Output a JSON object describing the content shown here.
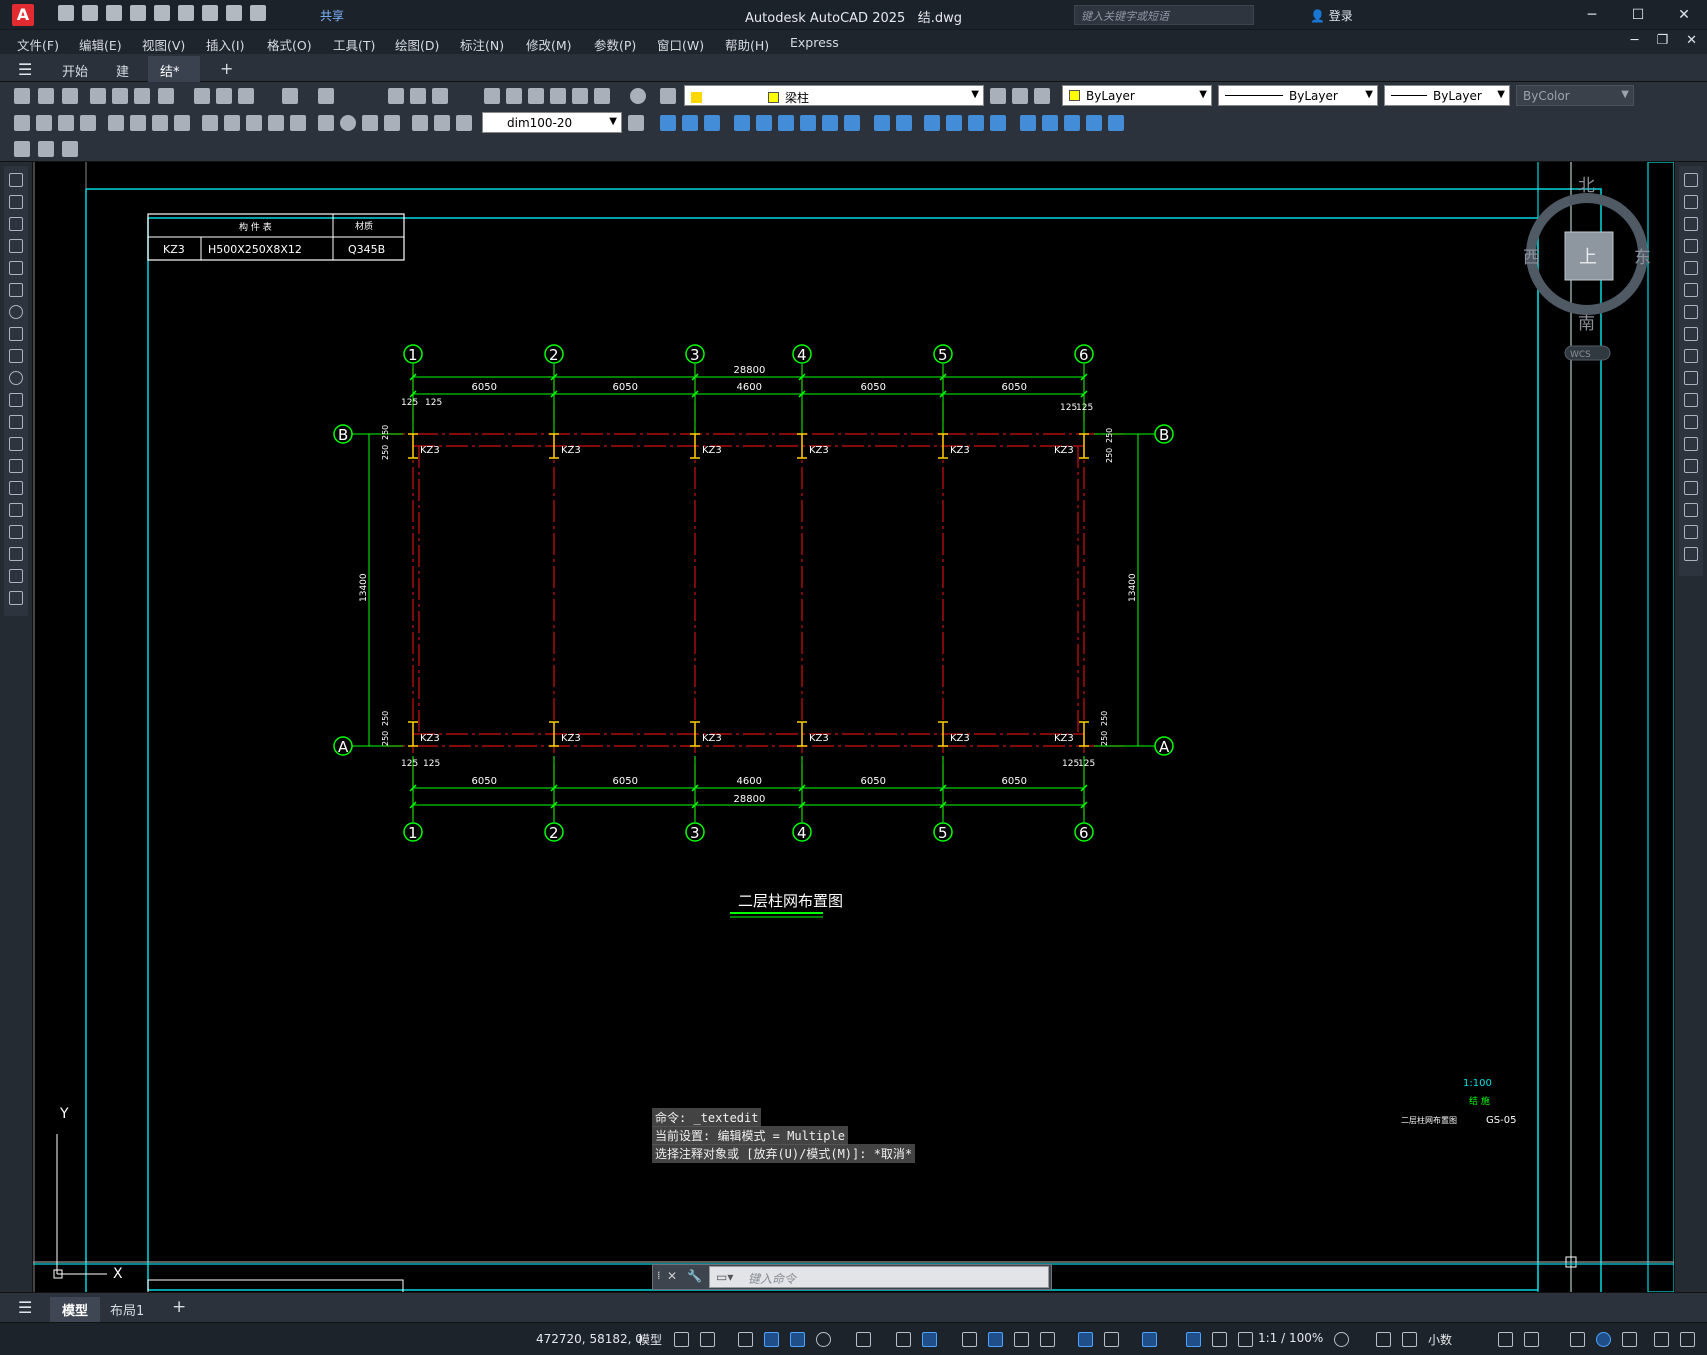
{
  "app": {
    "title": "Autodesk AutoCAD 2025",
    "document": "结.dwg",
    "logo": "A",
    "share": "共享",
    "search_placeholder": "键入关键字或短语",
    "login": "登录"
  },
  "window": {
    "minimize": "─",
    "maximize": "☐",
    "close": "✕"
  },
  "menu": [
    "文件(F)",
    "编辑(E)",
    "视图(V)",
    "插入(I)",
    "格式(O)",
    "工具(T)",
    "绘图(D)",
    "标注(N)",
    "修改(M)",
    "参数(P)",
    "窗口(W)",
    "帮助(H)",
    "Express"
  ],
  "tabs": {
    "start": "开始",
    "tab1": "建",
    "tab2": "结*",
    "add": "+"
  },
  "toolbar": {
    "layer": "梁柱",
    "color": "ByLayer",
    "linetype": "ByLayer",
    "lineweight": "ByLayer",
    "plotstyle": "ByColor",
    "dimstyle": "dim100-20"
  },
  "drawing": {
    "table_header1": "构 件 表",
    "table_header2": "材质",
    "table_col1": "KZ3",
    "table_col2": "H500X250X8X12",
    "table_col3": "Q345B",
    "axis_numbers": [
      "1",
      "2",
      "3",
      "4",
      "5",
      "6"
    ],
    "axis_letters": [
      "A",
      "B"
    ],
    "total": "28800",
    "spans": [
      "6050",
      "6050",
      "4600",
      "6050",
      "6050"
    ],
    "height": "13400",
    "offset125": "125",
    "offset250": "250",
    "column": "KZ3",
    "title": "二层柱网布置图",
    "scale": "1:100",
    "designer": "结 施",
    "sheet_title": "二层柱网布置图",
    "sheet_no": "GS-05",
    "ucs_y": "Y",
    "ucs_x": "X"
  },
  "viewcube": {
    "north": "北",
    "south": "南",
    "east": "东",
    "west": "西",
    "top": "上",
    "wcs": "WCS"
  },
  "command": {
    "history": [
      "命令: _textedit",
      "当前设置: 编辑模式 = Multiple",
      "选择注释对象或 [放弃(U)/模式(M)]: *取消*"
    ],
    "prompt": "键入命令"
  },
  "layout_tabs": {
    "model": "模型",
    "layout1": "布局1",
    "add": "+"
  },
  "status": {
    "coords": "472720, 58182, 0",
    "mode": "模型",
    "scale": "1:1 / 100%",
    "units": "小数"
  }
}
